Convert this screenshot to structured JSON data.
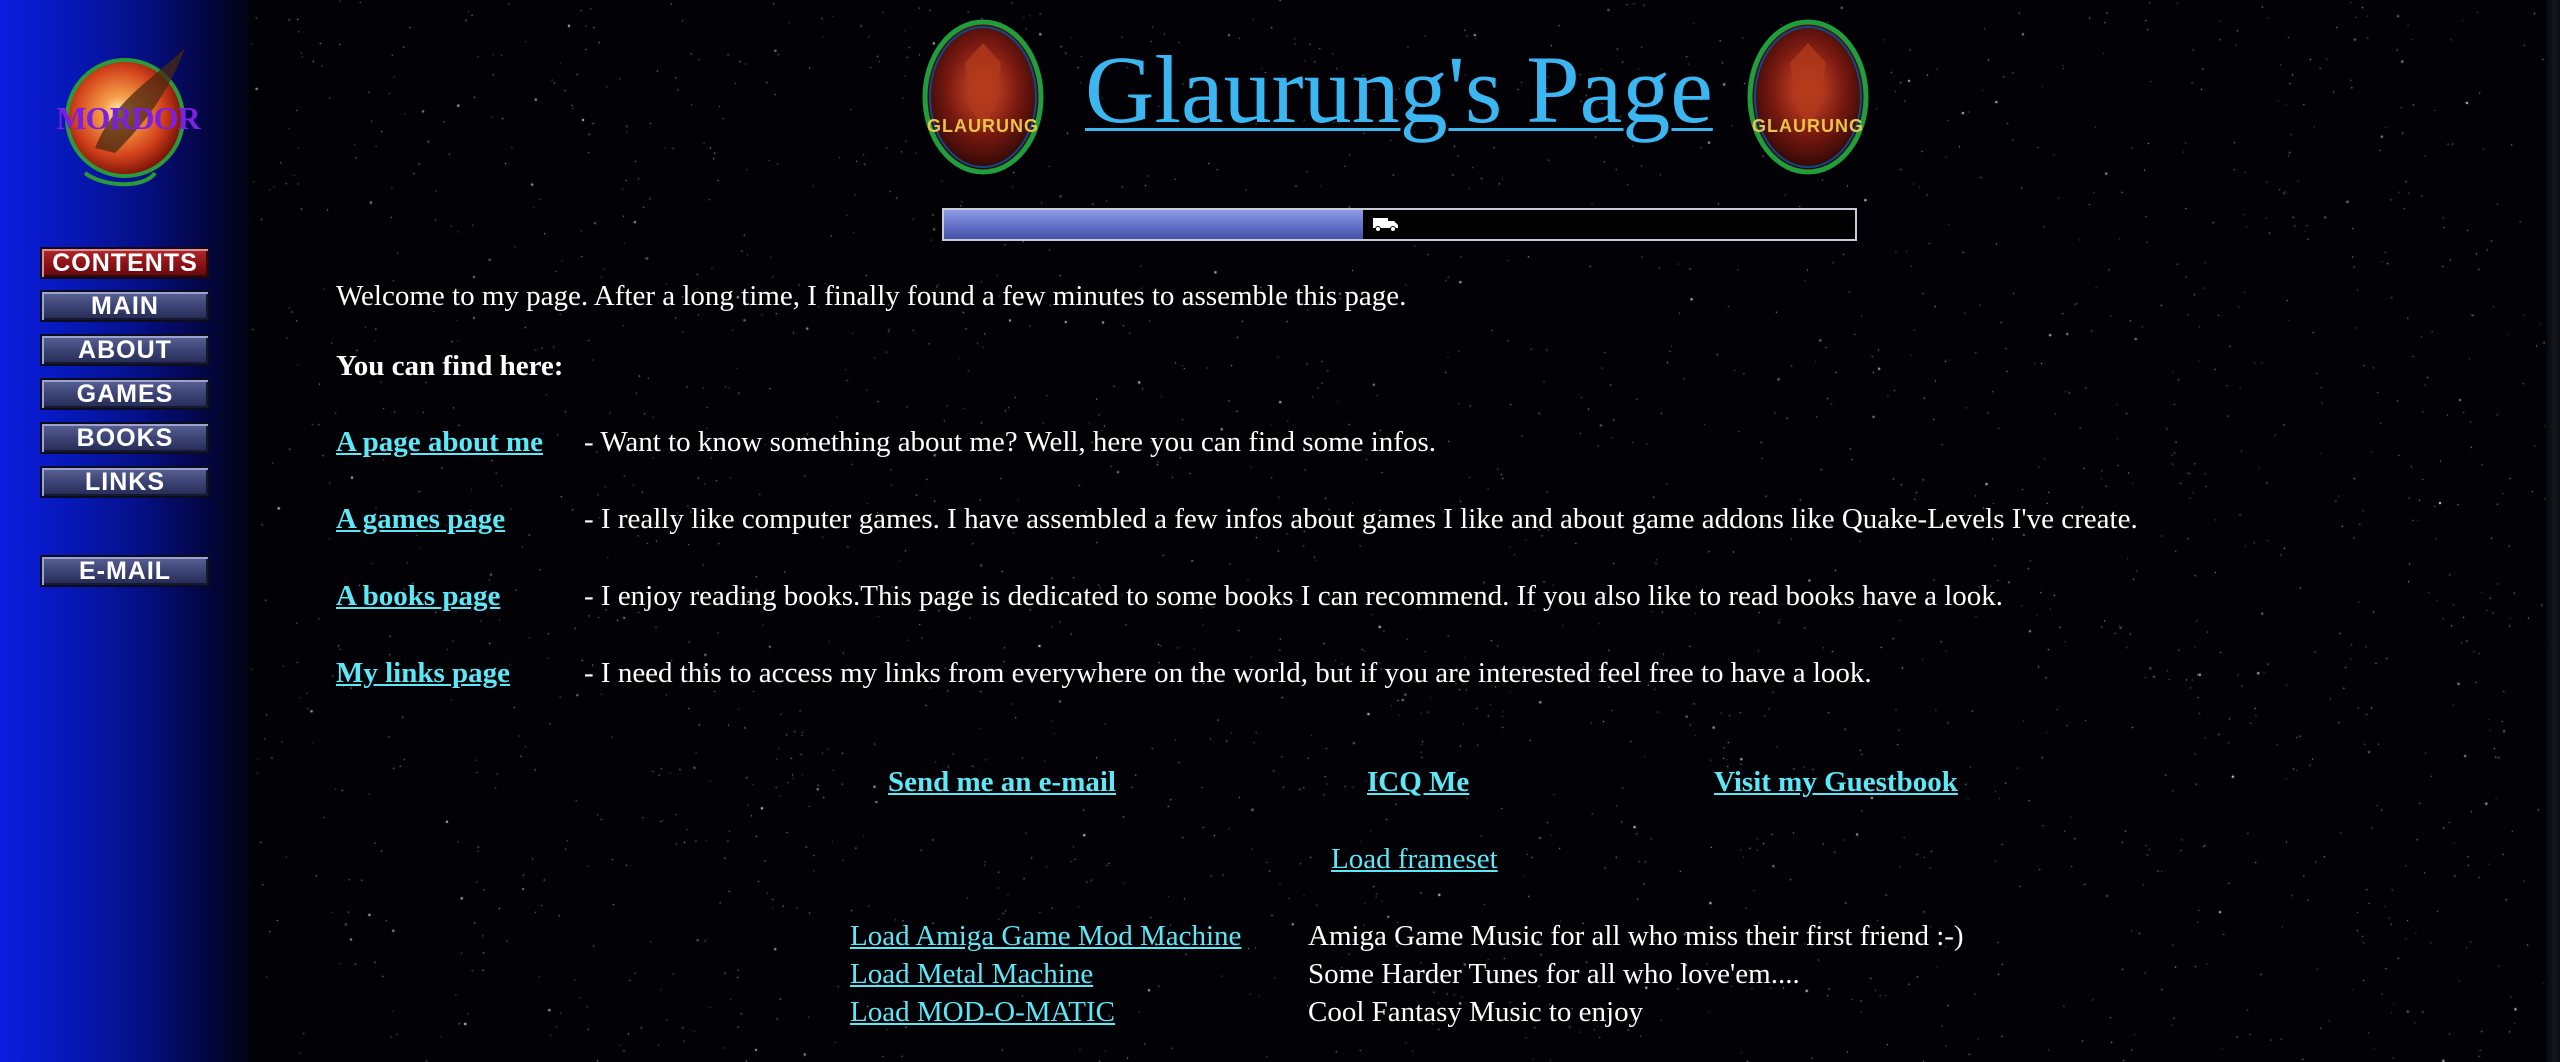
{
  "sidebar": {
    "logo_text": "MORDOR",
    "nav": [
      {
        "label": "CONTENTS",
        "active": true
      },
      {
        "label": "MAIN",
        "active": false
      },
      {
        "label": "ABOUT",
        "active": false
      },
      {
        "label": "GAMES",
        "active": false
      },
      {
        "label": "BOOKS",
        "active": false
      },
      {
        "label": "LINKS",
        "active": false
      }
    ],
    "email_label": "E-MAIL"
  },
  "header": {
    "title": "Glaurung's Page",
    "emblem_label": "GLAURUNG",
    "progress_fraction": 0.46
  },
  "intro": {
    "welcome": "Welcome to my page. After a long time, I finally found a few minutes to assemble this page.",
    "find_here": "You can find here:"
  },
  "sections": [
    {
      "link": "A page about me",
      "desc": "- Want to know something about me? Well, here you can find some infos."
    },
    {
      "link": "A games page",
      "desc": "- I really like computer games. I have assembled a few infos about games I like and about game addons like Quake-Levels I've create."
    },
    {
      "link": "A books page",
      "desc": "- I enjoy reading books.This page is dedicated to some books I can recommend. If you also like to read books have a look."
    },
    {
      "link": "My links page",
      "desc": "- I need this to access my links from everywhere on the world, but if you are interested feel free to have a look."
    }
  ],
  "footer_links": {
    "email": "Send me an e-mail",
    "icq": "ICQ Me",
    "guestbook": "Visit my Guestbook",
    "frameset": "Load frameset"
  },
  "music": [
    {
      "link": "Load Amiga Game Mod Machine",
      "desc": "Amiga Game Music for all who miss their first friend :-)"
    },
    {
      "link": "Load Metal Machine",
      "desc": "Some Harder Tunes for all who love'em...."
    },
    {
      "link": "Load MOD-O-MATIC",
      "desc": "Cool Fantasy Music to enjoy"
    }
  ],
  "colors": {
    "link": "#5de8f7",
    "title": "#3bb6f1",
    "sidebar_blue": "#0718b8",
    "active_button": "#8a1116"
  },
  "icons": [
    "logo-emblem",
    "dragon-emblem",
    "truck-icon"
  ]
}
